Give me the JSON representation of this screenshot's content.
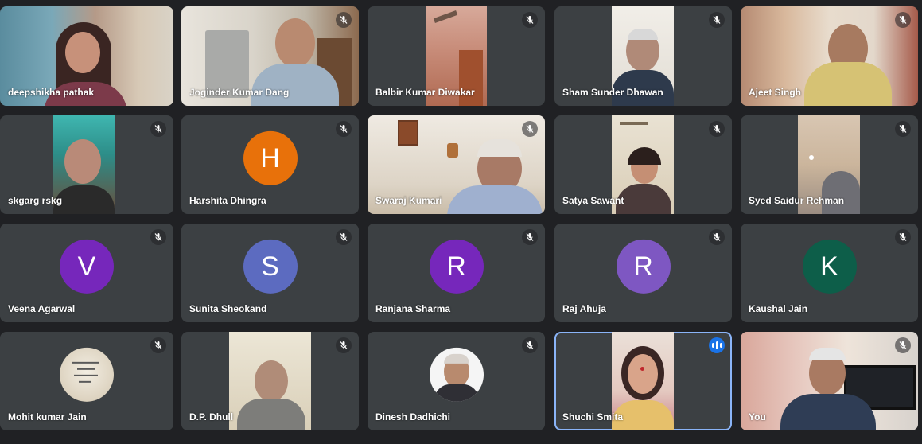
{
  "participants": [
    {
      "name": "deepshikha pathak"
    },
    {
      "name": "Joginder Kumar Dang"
    },
    {
      "name": "Balbir Kumar Diwakar"
    },
    {
      "name": "Sham Sunder Dhawan"
    },
    {
      "name": "Ajeet Singh"
    },
    {
      "name": "skgarg rskg"
    },
    {
      "name": "Harshita Dhingra",
      "initial": "H",
      "color": "#e8710a"
    },
    {
      "name": "Swaraj Kumari"
    },
    {
      "name": "Satya Sawant"
    },
    {
      "name": "Syed Saidur Rehman"
    },
    {
      "name": "Veena Agarwal",
      "initial": "V",
      "color": "#7627bb"
    },
    {
      "name": "Sunita Sheokand",
      "initial": "S",
      "color": "#5c6bc0"
    },
    {
      "name": "Ranjana Sharma",
      "initial": "R",
      "color": "#7627bb"
    },
    {
      "name": "Raj Ahuja",
      "initial": "R",
      "color": "#7e57c2"
    },
    {
      "name": "Kaushal Jain",
      "initial": "K",
      "color": "#0d5e49"
    },
    {
      "name": "Mohit kumar Jain"
    },
    {
      "name": "D.P. Dhull"
    },
    {
      "name": "Dinesh Dadhichi"
    },
    {
      "name": "Shuchi Smita"
    },
    {
      "name": "You"
    }
  ],
  "colors": {
    "background": "#202124",
    "tile": "#3c4043",
    "speaking_border": "#8ab4f8",
    "talk_indicator": "#1a73e8"
  },
  "icons": {
    "mute": "mic-off-icon",
    "talking": "audio-level-icon"
  }
}
